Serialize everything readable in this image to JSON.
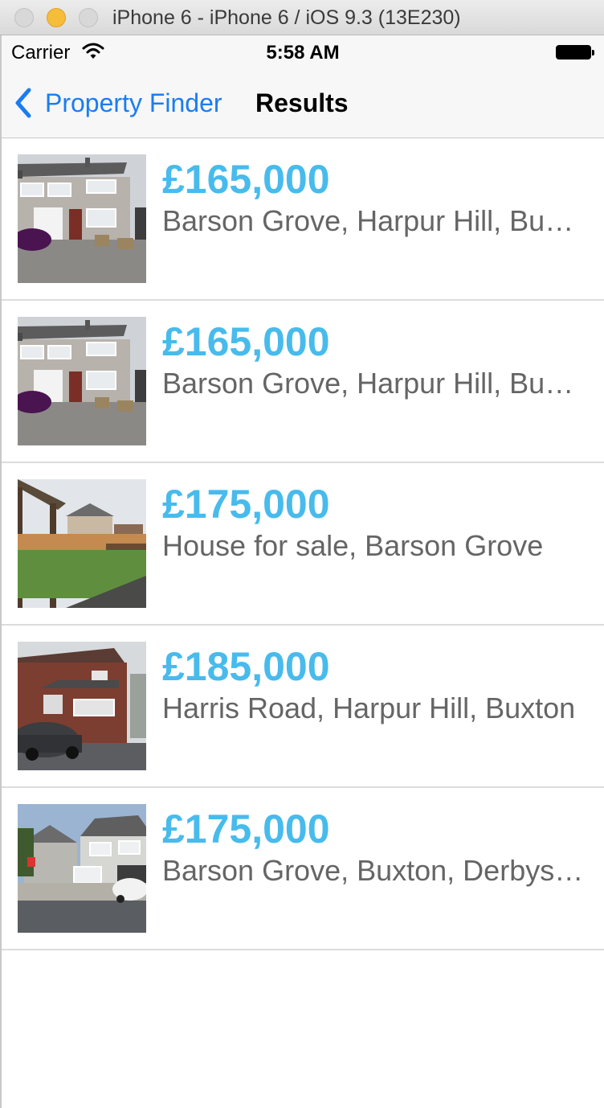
{
  "window": {
    "title": "iPhone 6 - iPhone 6 / iOS 9.3 (13E230)"
  },
  "status_bar": {
    "carrier": "Carrier",
    "time": "5:58 AM",
    "battery": 1.0
  },
  "nav": {
    "back_label": "Property Finder",
    "title": "Results"
  },
  "colors": {
    "accent": "#1a7cf3",
    "price": "#48bbec",
    "text": "#656565"
  },
  "results": [
    {
      "price": "£165,000",
      "title": "Barson Grove, Harpur Hill, Buxton"
    },
    {
      "price": "£165,000",
      "title": "Barson Grove, Harpur Hill, Buxton"
    },
    {
      "price": "£175,000",
      "title": "House for sale, Barson Grove"
    },
    {
      "price": "£185,000",
      "title": "Harris Road, Harpur Hill, Buxton"
    },
    {
      "price": "£175,000",
      "title": "Barson Grove, Buxton, Derbyshire"
    }
  ]
}
